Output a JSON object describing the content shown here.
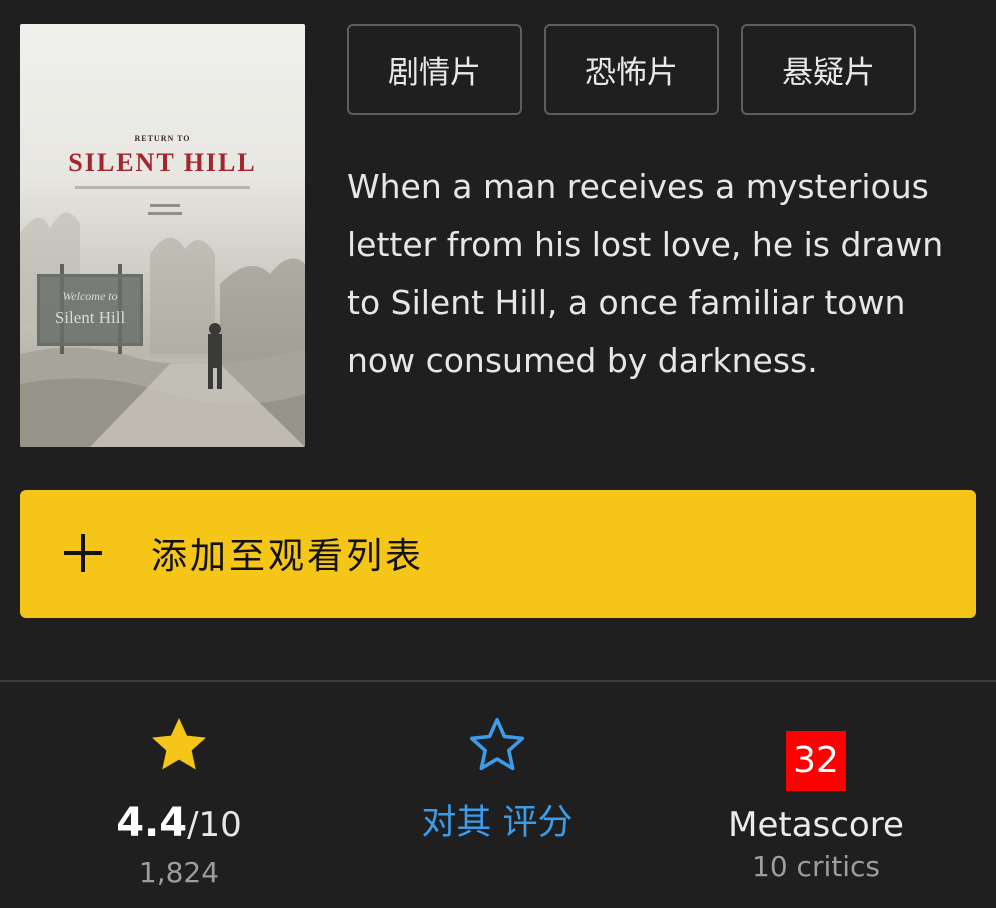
{
  "poster": {
    "subtitle": "RETURN TO",
    "title": "SILENT HILL",
    "sign_line1": "Welcome to",
    "sign_line2": "Silent Hill"
  },
  "genres": [
    "剧情片",
    "恐怖片",
    "悬疑片"
  ],
  "synopsis": "When a man receives a mysterious letter from his lost love, he is drawn to Silent Hill, a once familiar town now consumed by darkness.",
  "watchlist": {
    "icon": "plus-icon",
    "label": "添加至观看列表"
  },
  "ratings": {
    "imdb": {
      "icon": "star-filled-icon",
      "score": "4.4",
      "out_of": "/10",
      "count": "1,824"
    },
    "user": {
      "icon": "star-outline-icon",
      "label": "对其 评分"
    },
    "metascore": {
      "score": "32",
      "label": "Metascore",
      "critics": "10 critics"
    }
  },
  "colors": {
    "background": "#1f1f1f",
    "accent_yellow": "#f5c518",
    "link_blue": "#3d9be9",
    "metascore_red": "#ff0000"
  }
}
